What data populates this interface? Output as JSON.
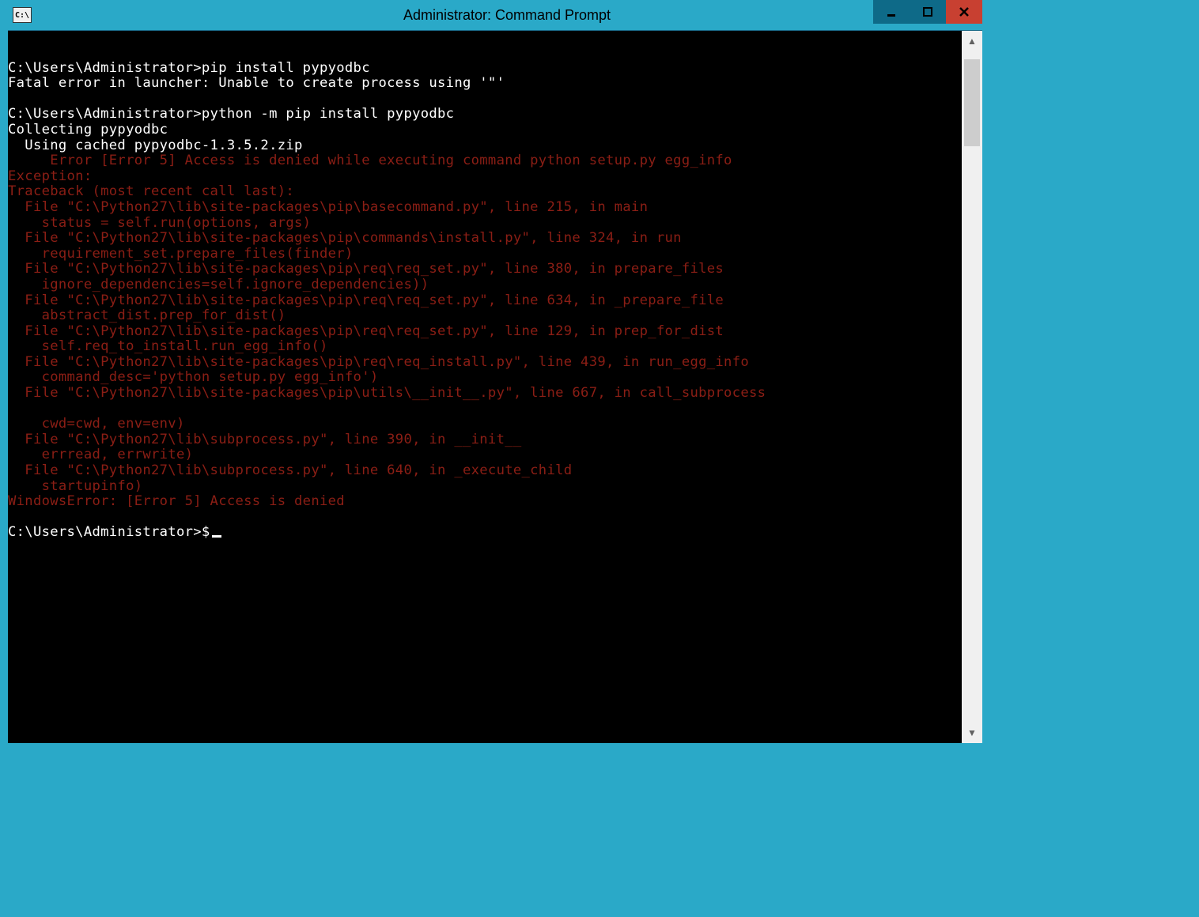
{
  "window": {
    "icon_text": "C:\\",
    "title": "Administrator: Command Prompt"
  },
  "console": {
    "lines": [
      {
        "cls": "line",
        "text": ""
      },
      {
        "cls": "line",
        "text": "C:\\Users\\Administrator>pip install pypyodbc"
      },
      {
        "cls": "line",
        "text": "Fatal error in launcher: Unable to create process using '\"'"
      },
      {
        "cls": "line",
        "text": ""
      },
      {
        "cls": "line",
        "text": "C:\\Users\\Administrator>python -m pip install pypyodbc"
      },
      {
        "cls": "line",
        "text": "Collecting pypyodbc"
      },
      {
        "cls": "line",
        "text": "  Using cached pypyodbc-1.3.5.2.zip"
      },
      {
        "cls": "err",
        "text": "     Error [Error 5] Access is denied while executing command python setup.py egg_info"
      },
      {
        "cls": "err",
        "text": "Exception:"
      },
      {
        "cls": "err",
        "text": "Traceback (most recent call last):"
      },
      {
        "cls": "err",
        "text": "  File \"C:\\Python27\\lib\\site-packages\\pip\\basecommand.py\", line 215, in main"
      },
      {
        "cls": "err",
        "text": "    status = self.run(options, args)"
      },
      {
        "cls": "err",
        "text": "  File \"C:\\Python27\\lib\\site-packages\\pip\\commands\\install.py\", line 324, in run"
      },
      {
        "cls": "err",
        "text": "    requirement_set.prepare_files(finder)"
      },
      {
        "cls": "err",
        "text": "  File \"C:\\Python27\\lib\\site-packages\\pip\\req\\req_set.py\", line 380, in prepare_files"
      },
      {
        "cls": "err",
        "text": "    ignore_dependencies=self.ignore_dependencies))"
      },
      {
        "cls": "err",
        "text": "  File \"C:\\Python27\\lib\\site-packages\\pip\\req\\req_set.py\", line 634, in _prepare_file"
      },
      {
        "cls": "err",
        "text": "    abstract_dist.prep_for_dist()"
      },
      {
        "cls": "err",
        "text": "  File \"C:\\Python27\\lib\\site-packages\\pip\\req\\req_set.py\", line 129, in prep_for_dist"
      },
      {
        "cls": "err",
        "text": "    self.req_to_install.run_egg_info()"
      },
      {
        "cls": "err",
        "text": "  File \"C:\\Python27\\lib\\site-packages\\pip\\req\\req_install.py\", line 439, in run_egg_info"
      },
      {
        "cls": "err",
        "text": "    command_desc='python setup.py egg_info')"
      },
      {
        "cls": "err",
        "text": "  File \"C:\\Python27\\lib\\site-packages\\pip\\utils\\__init__.py\", line 667, in call_subprocess"
      },
      {
        "cls": "err",
        "text": ""
      },
      {
        "cls": "err",
        "text": "    cwd=cwd, env=env)"
      },
      {
        "cls": "err",
        "text": "  File \"C:\\Python27\\lib\\subprocess.py\", line 390, in __init__"
      },
      {
        "cls": "err",
        "text": "    errread, errwrite)"
      },
      {
        "cls": "err",
        "text": "  File \"C:\\Python27\\lib\\subprocess.py\", line 640, in _execute_child"
      },
      {
        "cls": "err",
        "text": "    startupinfo)"
      },
      {
        "cls": "err",
        "text": "WindowsError: [Error 5] Access is denied"
      },
      {
        "cls": "line",
        "text": ""
      }
    ],
    "prompt_line": "C:\\Users\\Administrator>$"
  }
}
